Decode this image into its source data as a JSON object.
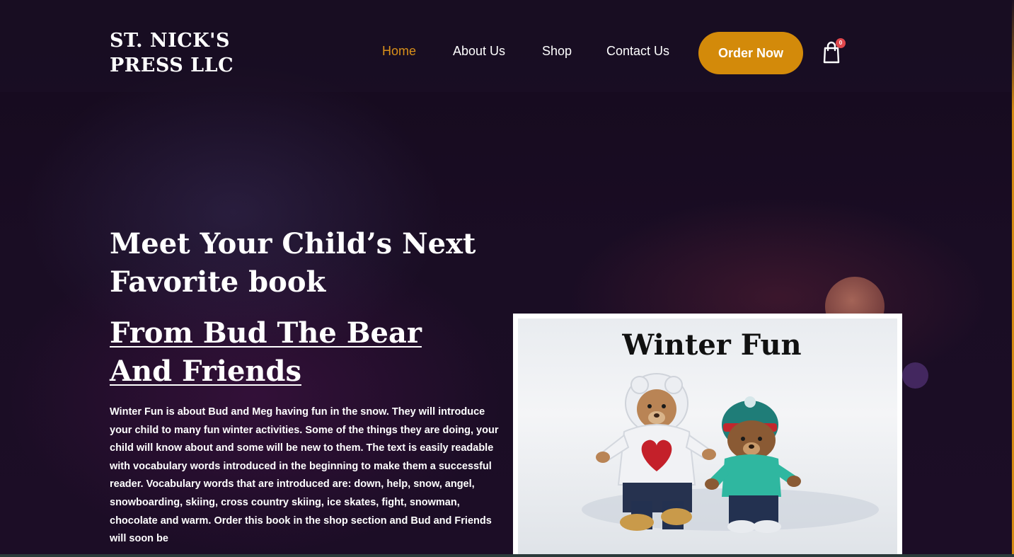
{
  "brand": {
    "line1": "ST. NICK'S",
    "line2": "PRESS LLC"
  },
  "nav": {
    "items": [
      {
        "label": "Home",
        "active": true
      },
      {
        "label": "About Us",
        "active": false
      },
      {
        "label": "Shop",
        "active": false
      },
      {
        "label": "Contact Us",
        "active": false
      }
    ],
    "order_label": "Order Now",
    "cart_count": "0"
  },
  "hero": {
    "title": "Meet Your Child’s Next Favorite book",
    "book_title": "From Bud The Bear And Friends",
    "description": "Winter Fun is about Bud and Meg having fun in the snow.  They will introduce your child to many fun winter activities.  Some of the things they are doing, your child will know about and some will be new to them.  The text is easily readable with vocabulary words introduced in the beginning to make them a successful reader.  Vocabulary words that are introduced are: down, help, snow, angel, snowboarding, skiing, cross country skiing, ice skates, fight, snowman, chocolate and warm.  Order this book in the shop section and Bud and Friends will soon be"
  },
  "book_cover": {
    "title": "Winter Fun"
  },
  "colors": {
    "accent": "#d38a0a",
    "active_nav": "#d9901a",
    "background": "#170c22",
    "cart_badge": "#e0474c"
  },
  "icons": {
    "cart": "shopping-bag-icon"
  }
}
